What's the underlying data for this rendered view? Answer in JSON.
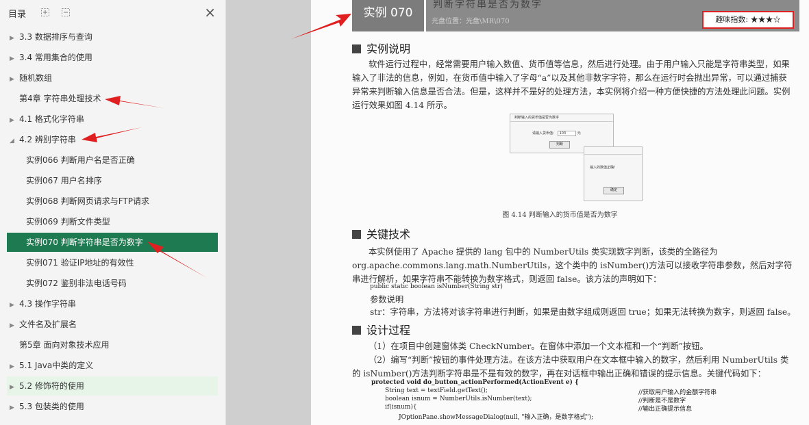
{
  "sidebar": {
    "title": "目录",
    "expand_icon": "expand-icon",
    "collapse_icon": "collapse-icon",
    "close_glyph": "×",
    "items": [
      {
        "label": "3.3 数据排序与查询",
        "arrow": "▶",
        "state": "normal"
      },
      {
        "label": "3.4 常用集合的使用",
        "arrow": "▶",
        "state": "normal"
      },
      {
        "label": "随机数组",
        "arrow": "▶",
        "state": "normal"
      },
      {
        "label": "第4章 字符串处理技术",
        "arrow": "",
        "state": "normal"
      },
      {
        "label": "4.1 格式化字符串",
        "arrow": "▶",
        "state": "normal"
      },
      {
        "label": "4.2 辨别字符串",
        "arrow": "◢",
        "state": "normal"
      },
      {
        "label": "实例066 判断用户名是否正确",
        "arrow": "",
        "state": "normal"
      },
      {
        "label": "实例067 用户名排序",
        "arrow": "",
        "state": "normal"
      },
      {
        "label": "实例068 判断网页请求与FTP请求",
        "arrow": "",
        "state": "normal"
      },
      {
        "label": "实例069 判断文件类型",
        "arrow": "",
        "state": "normal"
      },
      {
        "label": "实例070 判断字符串是否为数字",
        "arrow": "",
        "state": "active"
      },
      {
        "label": "实例071 验证IP地址的有效性",
        "arrow": "",
        "state": "normal"
      },
      {
        "label": "实例072 鉴别非法电话号码",
        "arrow": "",
        "state": "normal"
      },
      {
        "label": "4.3 操作字符串",
        "arrow": "▶",
        "state": "normal"
      },
      {
        "label": "文件名及扩展名",
        "arrow": "▶",
        "state": "normal"
      },
      {
        "label": "第5章 面向对象技术应用",
        "arrow": "",
        "state": "normal"
      },
      {
        "label": "5.1 Java中类的定义",
        "arrow": "▶",
        "state": "normal"
      },
      {
        "label": "5.2 修饰符的使用",
        "arrow": "▶",
        "state": "hover"
      },
      {
        "label": "5.3 包装类的使用",
        "arrow": "▶",
        "state": "normal"
      }
    ]
  },
  "page": {
    "example_badge": "实例 070",
    "example_title": "判断字符串是否为数字",
    "location": "光盘位置：光盘\\MR\\070",
    "fun_index_label": "趣味指数:",
    "fun_index_stars": "★★★☆",
    "sections": {
      "desc_title": "实例说明",
      "desc_text": "软件运行过程中，经常需要用户输入数值、货币值等信息，然后进行处理。由于用户输入只能是字符串类型，如果输入了非法的信息，例如，在货币值中输入了字母“a”以及其他非数字字符，那么在运行时会抛出异常，可以通过捕获异常来判断输入信息是否合法。但是，这样并不是好的处理方法，本实例将介绍一种方便快捷的方法处理此问题。实例运行效果如图 4.14 所示。",
      "figure_caption": "图 4.14   判断输入的货币值是否为数字",
      "fig_win1_title": "判断输入的货币值是否为数字",
      "fig_win1_label": "请输入货币值：",
      "fig_win1_value": "103",
      "fig_win1_unit": "元",
      "fig_win1_button": "判断",
      "fig_win2_msg": "输入的数值正确！",
      "fig_win2_button": "确定",
      "key_title": "关键技术",
      "key_text": "本实例使用了 Apache 提供的 lang 包中的 NumberUtils 类实现数字判断，该类的全路径为 org.apache.commons.lang.math.NumberUtils，这个类中的 isNumber()方法可以接收字符串参数，然后对字符串进行解析，如果字符串不能转换为数字格式，则返回 false。该方法的声明如下：",
      "key_decl": "public static boolean isNumber(String str)",
      "param_title": "参数说明",
      "param_text": "str：字符串，方法将对该字符串进行判断，如果是由数字组成则返回 true；如果无法转换为数字，则返回 false。",
      "design_title": "设计过程",
      "design_step1": "（1）在项目中创建窗体类 CheckNumber。在窗体中添加一个文本框和一个“判断”按钮。",
      "design_step2": "（2）编写“判断”按钮的事件处理方法。在该方法中获取用户在文本框中输入的数字，然后利用 NumberUtils 类的 isNumber()方法判断字符串是不是有效的数字，再在对话框中输出正确和错误的提示信息。关键代码如下：",
      "code_lines": [
        "protected void do_button_actionPerformed(ActionEvent e) {",
        "String text = textField.getText();",
        "boolean isnum = NumberUtils.isNumber(text);",
        "if(isnum){",
        "JOptionPane.showMessageDialog(null, \"输入正确，是数字格式\");"
      ],
      "code_comments": [
        "//获取用户输入的金额字符串",
        "//判断是不是数字",
        "//输出正确提示信息"
      ]
    }
  },
  "colors": {
    "active_bg": "#1e7a50",
    "hover_bg": "#e6f5e8",
    "annotation_red": "#e02020"
  }
}
